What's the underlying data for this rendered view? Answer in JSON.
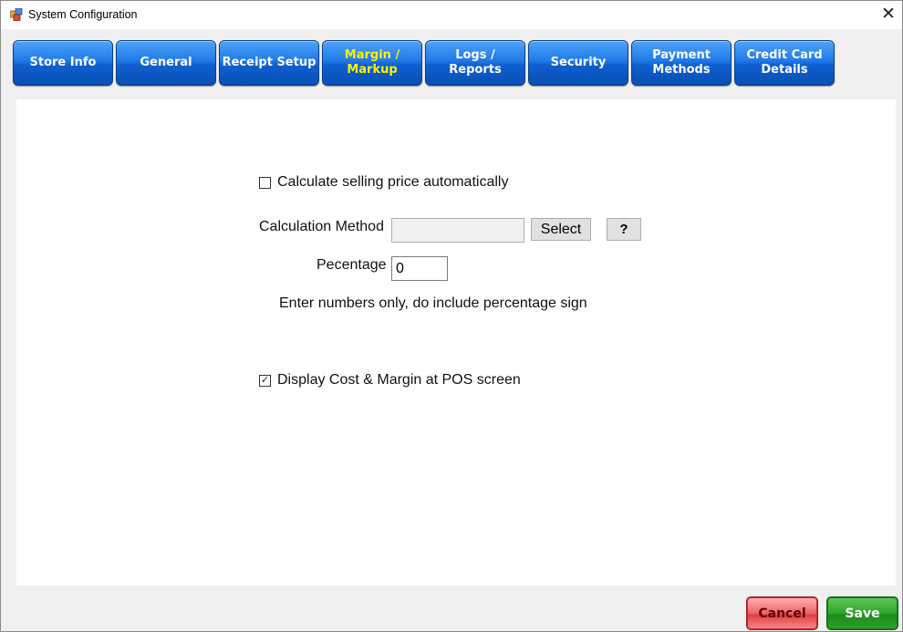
{
  "window": {
    "title": "System Configuration",
    "close_glyph": "✕"
  },
  "tabs": [
    {
      "label": "Store Info",
      "active": false
    },
    {
      "label": "General",
      "active": false
    },
    {
      "label": "Receipt Setup",
      "active": false
    },
    {
      "label": "Margin /\nMarkup",
      "active": true
    },
    {
      "label": "Logs /\nReports",
      "active": false
    },
    {
      "label": "Security",
      "active": false
    },
    {
      "label": "Payment\nMethods",
      "active": false
    },
    {
      "label": "Credit Card\nDetails",
      "active": false
    }
  ],
  "margin": {
    "auto_price_label": "Calculate selling price automatically",
    "auto_price_checked": false,
    "method_label": "Calculation Method",
    "method_value": "",
    "select_button": "Select",
    "help_button": "?",
    "percentage_label": "Pecentage",
    "percentage_value": "0",
    "hint": "Enter numbers only, do include percentage sign",
    "display_cost_label": "Display Cost & Margin  at POS screen",
    "display_cost_checked": true
  },
  "footer": {
    "cancel": "Cancel",
    "save": "Save"
  },
  "colors": {
    "tab_active_text": "#fff200",
    "tab_blue": "#1f7ae8",
    "cancel": "#e04040",
    "save": "#2ea52b"
  }
}
